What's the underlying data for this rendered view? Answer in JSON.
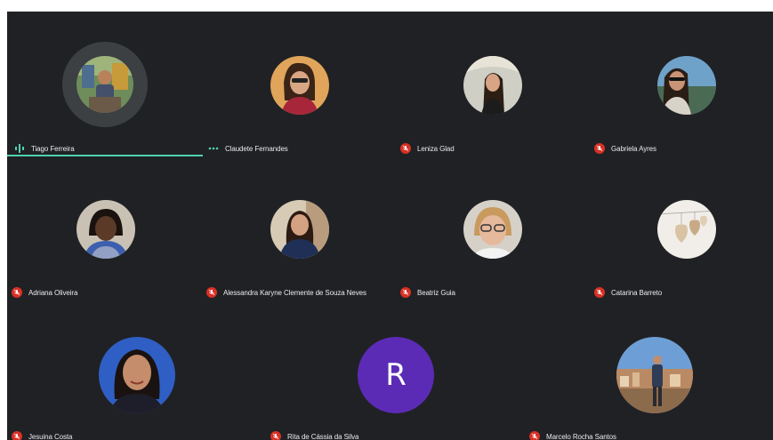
{
  "meeting": {
    "participants": [
      {
        "name": "Tiago Ferreira",
        "status": "speaking"
      },
      {
        "name": "Claudete Fernandes",
        "status": "active"
      },
      {
        "name": "Leniza Glad",
        "status": "muted"
      },
      {
        "name": "Gabriela Ayres",
        "status": "muted"
      },
      {
        "name": "Adriana Oliveira",
        "status": "muted"
      },
      {
        "name": "Alessandra Karyne Clemente de Souza Neves",
        "status": "muted"
      },
      {
        "name": "Beatriz Guia",
        "status": "muted"
      },
      {
        "name": "Catarina Barreto",
        "status": "muted"
      },
      {
        "name": "Jesuina Costa",
        "status": "muted"
      },
      {
        "name": "Rita de Cássia da Silva",
        "status": "muted",
        "initial": "R"
      },
      {
        "name": "Marcelo Rocha Santos",
        "status": "muted"
      }
    ]
  },
  "colors": {
    "background": "#202124",
    "mute": "#d93025",
    "speaking": "#4fd1b2",
    "initial_avatar": "#5b2bb5"
  }
}
